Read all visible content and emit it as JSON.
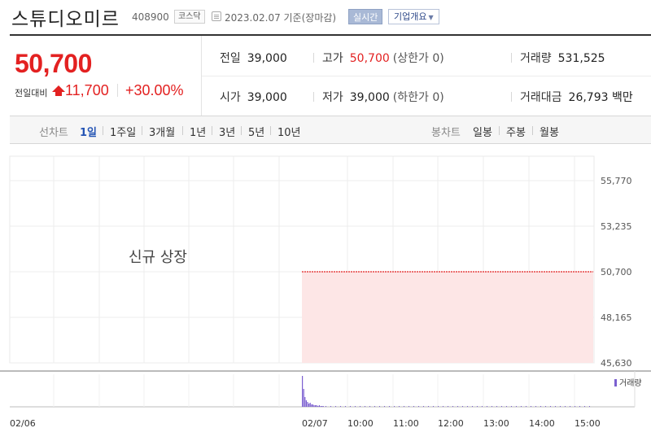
{
  "header": {
    "stock_name": "스튜디오미르",
    "stock_code": "408900",
    "market": "코스닥",
    "date_text": "2023.02.07  기준(장마감)",
    "realtime_label": "실시간",
    "company_label": "기업개요"
  },
  "summary": {
    "current_price": "50,700",
    "change_label": "전일대비",
    "change_value": "11,700",
    "change_percent": "+30.00%",
    "stats": {
      "prev_close": {
        "label": "전일",
        "value": "39,000"
      },
      "high": {
        "label": "고가",
        "value": "50,700",
        "limit": "(상한가 0)"
      },
      "volume": {
        "label": "거래량",
        "value": "531,525"
      },
      "open": {
        "label": "시가",
        "value": "39,000"
      },
      "low": {
        "label": "저가",
        "value": "39,000",
        "limit": "(하한가 0)"
      },
      "amount": {
        "label": "거래대금",
        "value": "26,793 백만"
      }
    }
  },
  "periods": {
    "line_title": "선차트",
    "line_items": [
      "1일",
      "1주일",
      "3개월",
      "1년",
      "3년",
      "5년",
      "10년"
    ],
    "candle_title": "봉차트",
    "candle_items": [
      "일봉",
      "주봉",
      "월봉"
    ],
    "active": "1일"
  },
  "colors": {
    "up": "#e32121",
    "accent": "#2454b4",
    "area_fill": "#fde6e6",
    "volume_bar": "#7b5fd0"
  },
  "chart_data": {
    "type": "area",
    "listing_note": "신규 상장",
    "y_ticks": [
      "55,770",
      "53,235",
      "50,700",
      "48,165",
      "45,630"
    ],
    "y_tick_values": [
      55770,
      53235,
      50700,
      48165,
      45630
    ],
    "ylim": [
      45630,
      55770
    ],
    "x_labels": [
      "02/06",
      "02/07",
      "10:00",
      "11:00",
      "12:00",
      "13:00",
      "14:00",
      "15:00"
    ],
    "series": [
      {
        "name": "",
        "x_start": "02/07 09:00",
        "x_end": "02/07 15:30",
        "value": 50700
      }
    ],
    "volume_legend": "거래량",
    "grid": true
  }
}
